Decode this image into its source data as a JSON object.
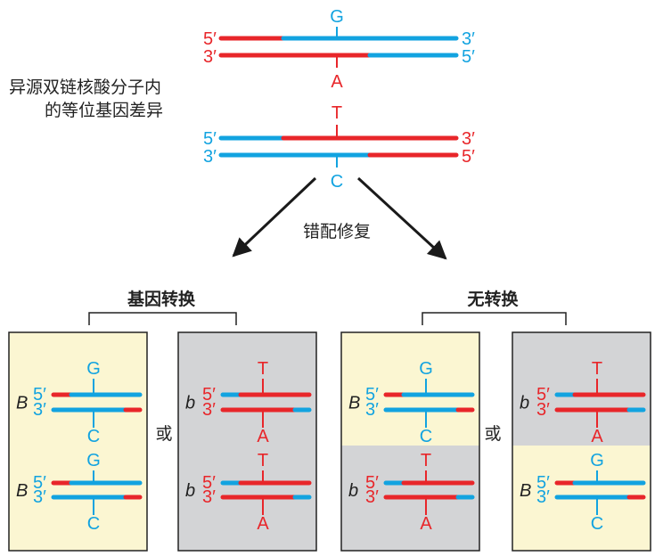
{
  "colors": {
    "red": "#e8262a",
    "blue": "#12a3e0",
    "black": "#222222",
    "cream": "#fbf6d2",
    "gray": "#d3d4d6",
    "arrow": "#1a1a1a"
  },
  "labels": {
    "side_line1": "异源双链核酸分子内",
    "side_line2": "的等位基因差异",
    "repair": "错配修复",
    "gene_conversion": "基因转换",
    "no_conversion": "无转换",
    "or": "或"
  },
  "top_duplex_1": {
    "top_base": "G",
    "bottom_base": "A",
    "end_5": "5′",
    "end_3": "3′"
  },
  "top_duplex_2": {
    "top_base": "T",
    "bottom_base": "C",
    "end_5": "5′",
    "end_3": "3′"
  },
  "panels": [
    {
      "upper": {
        "allele": "B",
        "top_base": "G",
        "bottom_base": "C"
      },
      "lower": {
        "allele": "B",
        "top_base": "G",
        "bottom_base": "C"
      }
    },
    {
      "upper": {
        "allele": "b",
        "top_base": "T",
        "bottom_base": "A"
      },
      "lower": {
        "allele": "b",
        "top_base": "T",
        "bottom_base": "A"
      }
    },
    {
      "upper": {
        "allele": "B",
        "top_base": "G",
        "bottom_base": "C"
      },
      "lower": {
        "allele": "b",
        "top_base": "T",
        "bottom_base": "A"
      }
    },
    {
      "upper": {
        "allele": "b",
        "top_base": "T",
        "bottom_base": "A"
      },
      "lower": {
        "allele": "B",
        "top_base": "G",
        "bottom_base": "C"
      }
    }
  ],
  "strand_end_labels": {
    "p5": "5′",
    "p3": "3′"
  }
}
